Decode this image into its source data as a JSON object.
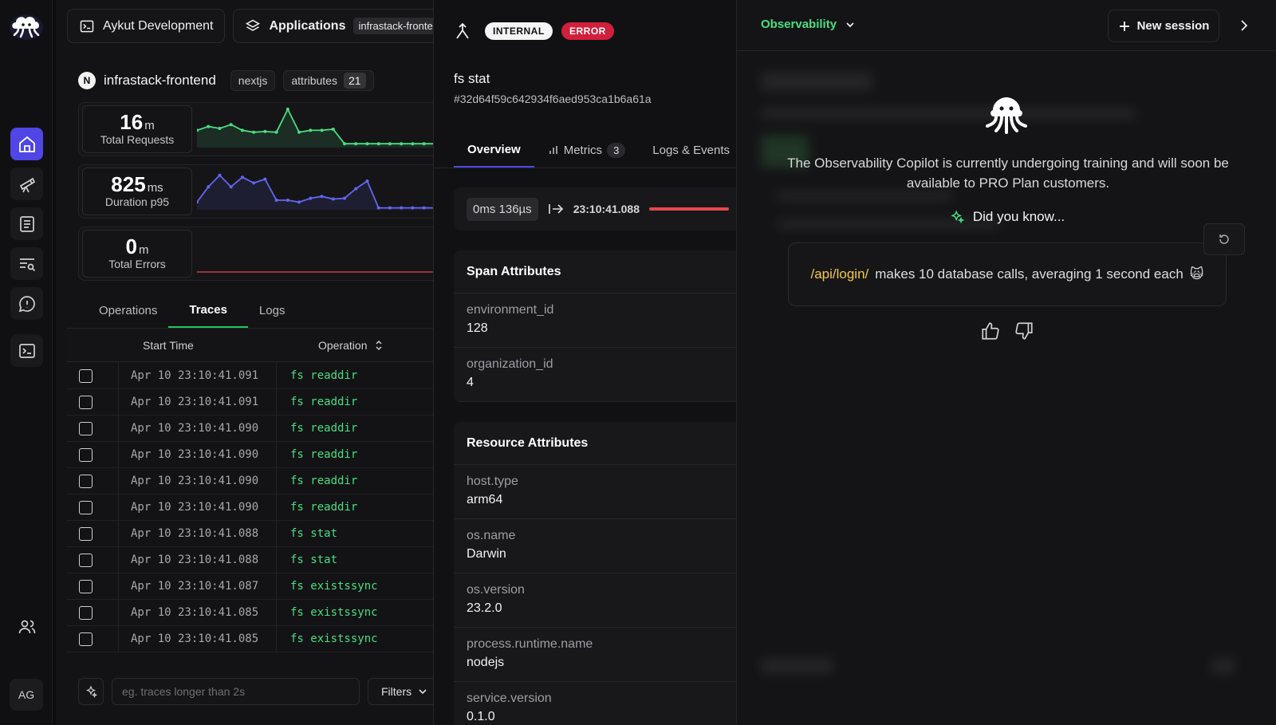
{
  "rail": {
    "avatar": "AG",
    "items": [
      "home-icon",
      "telescope-icon",
      "document-icon",
      "search-list-icon",
      "alert-message-icon",
      "terminal-icon",
      "users-icon"
    ]
  },
  "topbar": {
    "project_label": "Aykut Development",
    "applications_label": "Applications",
    "app_chip": "infrastack-frontend"
  },
  "service": {
    "logo_letter": "N",
    "name": "infrastack-frontend",
    "framework_tag": "nextjs",
    "attributes_label": "attributes",
    "attributes_count": "21"
  },
  "metrics": [
    {
      "value": "16",
      "unit": "m",
      "label": "Total Requests",
      "color": "#4ade80",
      "series": [
        0.45,
        0.55,
        0.5,
        0.6,
        0.45,
        0.4,
        0.42,
        0.4,
        1.0,
        0.4,
        0.45,
        0.45,
        0.48,
        0.1,
        0.1,
        0.1,
        0.1,
        0.1,
        0.1,
        0.1,
        0.1,
        0.1,
        0.1,
        0.1,
        0.1,
        0.1,
        0.1
      ]
    },
    {
      "value": "825",
      "unit": "ms",
      "label": "Duration p95",
      "color": "#6366f1",
      "series": [
        0.2,
        0.6,
        0.9,
        0.6,
        0.85,
        0.7,
        0.8,
        0.25,
        0.25,
        0.2,
        0.3,
        0.35,
        0.28,
        0.3,
        0.55,
        0.75,
        0.05,
        0.05,
        0.05,
        0.05,
        0.05,
        0.05,
        0.05,
        0.05,
        0.05,
        0.05,
        0.05
      ]
    },
    {
      "value": "0",
      "unit": "m",
      "label": "Total Errors",
      "color": "#e5484d",
      "series": []
    }
  ],
  "tabs": {
    "operations": "Operations",
    "traces": "Traces",
    "logs": "Logs"
  },
  "table": {
    "col_start": "Start Time",
    "col_operation": "Operation",
    "rows": [
      {
        "time": "Apr 10 23:10:41.091",
        "op": "fs readdir"
      },
      {
        "time": "Apr 10 23:10:41.091",
        "op": "fs readdir"
      },
      {
        "time": "Apr 10 23:10:41.090",
        "op": "fs readdir"
      },
      {
        "time": "Apr 10 23:10:41.090",
        "op": "fs readdir"
      },
      {
        "time": "Apr 10 23:10:41.090",
        "op": "fs readdir"
      },
      {
        "time": "Apr 10 23:10:41.090",
        "op": "fs readdir"
      },
      {
        "time": "Apr 10 23:10:41.088",
        "op": "fs stat"
      },
      {
        "time": "Apr 10 23:10:41.088",
        "op": "fs stat"
      },
      {
        "time": "Apr 10 23:10:41.087",
        "op": "fs existssync"
      },
      {
        "time": "Apr 10 23:10:41.085",
        "op": "fs existssync"
      },
      {
        "time": "Apr 10 23:10:41.085",
        "op": "fs existssync"
      }
    ]
  },
  "search": {
    "placeholder": "eg. traces longer than 2s",
    "filters_label": "Filters"
  },
  "span": {
    "kind_badge": "INTERNAL",
    "status_badge": "ERROR",
    "name": "fs stat",
    "id": "#32d64f59c642934f6aed953ca1b6a61a",
    "tabs": {
      "overview": "Overview",
      "metrics": "Metrics",
      "metrics_count": "3",
      "logs": "Logs & Events"
    },
    "duration": "0ms 136µs",
    "timestamp": "23:10:41.088",
    "span_attributes_title": "Span Attributes",
    "span_attributes": [
      {
        "k": "environment_id",
        "v": "128"
      },
      {
        "k": "organization_id",
        "v": "4"
      }
    ],
    "resource_attributes_title": "Resource Attributes",
    "resource_attributes": [
      {
        "k": "host.type",
        "v": "arm64"
      },
      {
        "k": "os.name",
        "v": "Darwin"
      },
      {
        "k": "os.version",
        "v": "23.2.0"
      },
      {
        "k": "process.runtime.name",
        "v": "nodejs"
      },
      {
        "k": "service.version",
        "v": "0.1.0"
      }
    ]
  },
  "copilot": {
    "selector": "Observability",
    "new_session": "New session",
    "message": "The Observability Copilot is currently undergoing training and will soon be available to PRO Plan customers.",
    "did_you_know": "Did you know...",
    "tip_path": "/api/login/",
    "tip_text": "makes 10 database calls, averaging 1 second each",
    "tip_emoji": "🙀"
  }
}
